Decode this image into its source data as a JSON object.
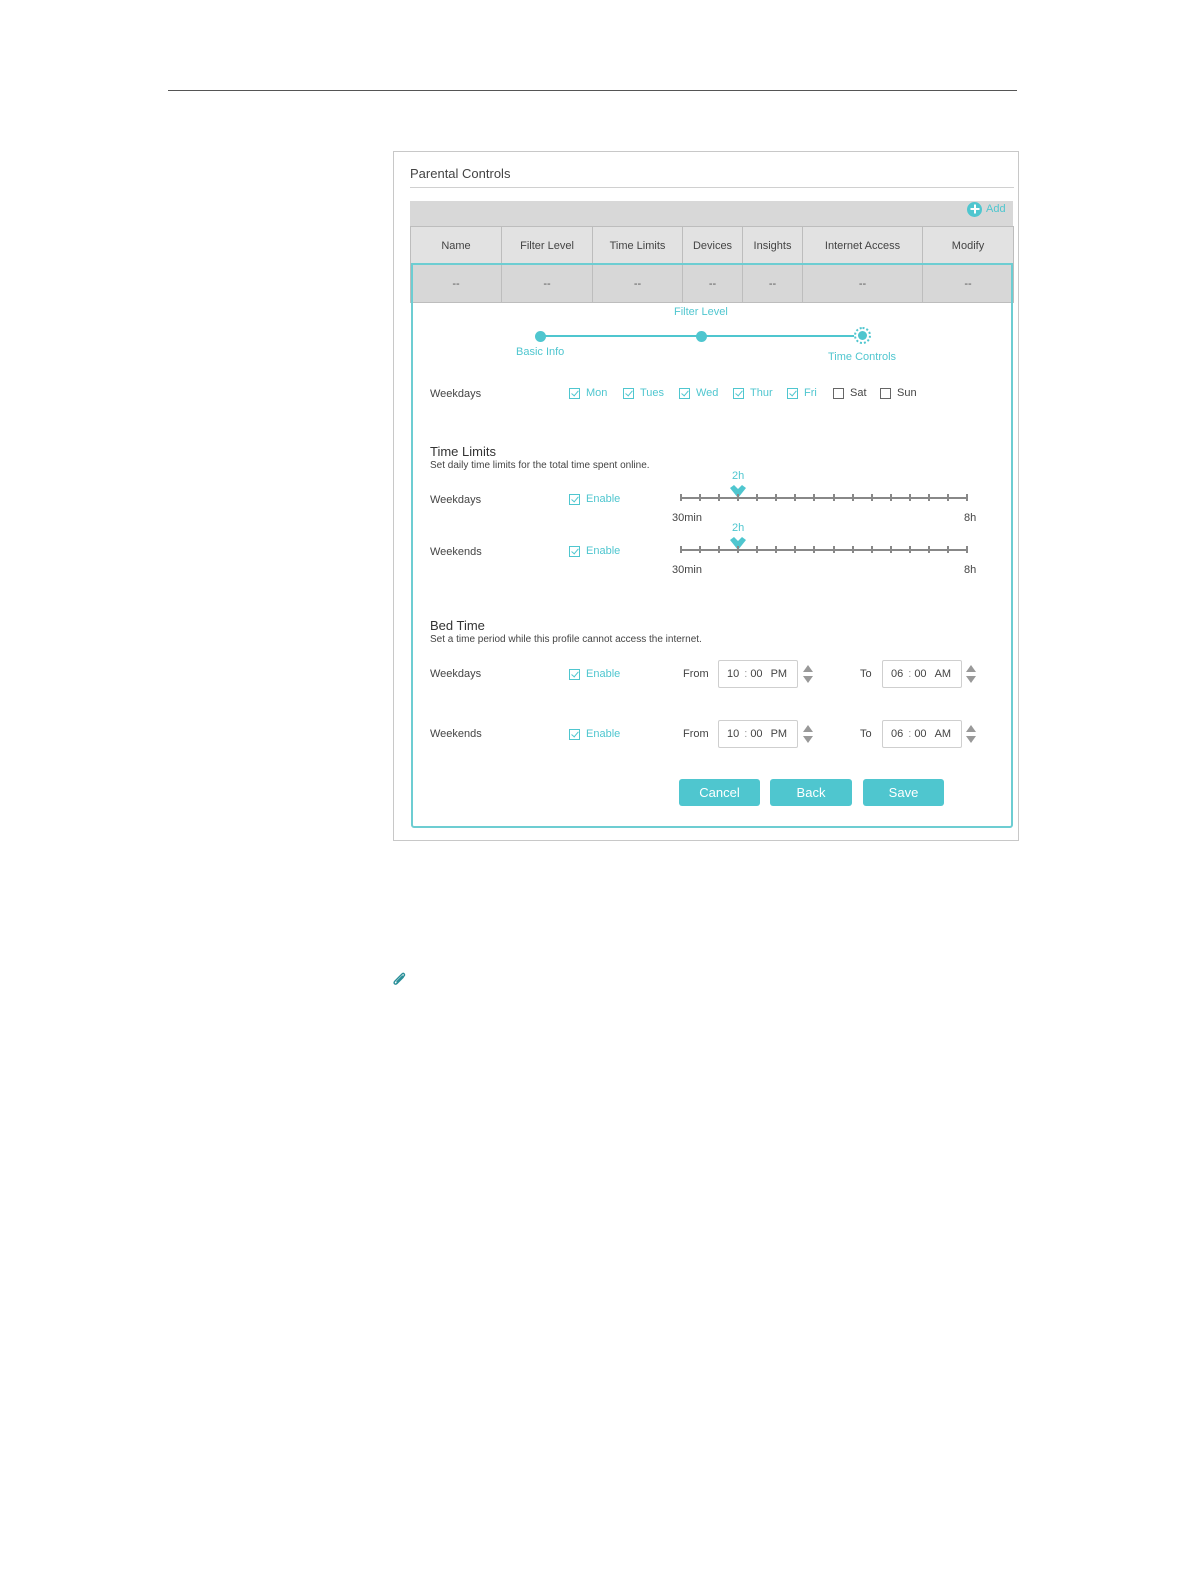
{
  "panel": {
    "title": "Parental Controls",
    "add_label": "Add"
  },
  "table": {
    "columns": [
      "Name",
      "Filter Level",
      "Time Limits",
      "Devices",
      "Insights",
      "Internet Access",
      "Modify"
    ],
    "row": [
      "--",
      "--",
      "--",
      "--",
      "--",
      "--",
      "--"
    ]
  },
  "steps": {
    "basic": "Basic Info",
    "filter": "Filter Level",
    "time": "Time Controls"
  },
  "weekdays": {
    "label": "Weekdays",
    "days": [
      {
        "name": "Mon",
        "checked": true
      },
      {
        "name": "Tues",
        "checked": true
      },
      {
        "name": "Wed",
        "checked": true
      },
      {
        "name": "Thur",
        "checked": true
      },
      {
        "name": "Fri",
        "checked": true
      },
      {
        "name": "Sat",
        "checked": false
      },
      {
        "name": "Sun",
        "checked": false
      }
    ]
  },
  "time_limits": {
    "title": "Time Limits",
    "desc": "Set daily time limits for the total time spent online.",
    "weekdays_label": "Weekdays",
    "weekends_label": "Weekends",
    "enable_label": "Enable",
    "min_label": "30min",
    "max_label": "8h",
    "weekdays_value": "2h",
    "weekends_value": "2h",
    "weekdays_fraction": 0.2,
    "weekends_fraction": 0.2
  },
  "bed_time": {
    "title": "Bed Time",
    "desc": "Set a time period while this profile cannot access the internet.",
    "enable_label": "Enable",
    "from_label": "From",
    "to_label": "To",
    "weekdays": {
      "label": "Weekdays",
      "from": {
        "h": "10",
        "m": "00",
        "ampm": "PM"
      },
      "to": {
        "h": "06",
        "m": "00",
        "ampm": "AM"
      }
    },
    "weekends": {
      "label": "Weekends",
      "from": {
        "h": "10",
        "m": "00",
        "ampm": "PM"
      },
      "to": {
        "h": "06",
        "m": "00",
        "ampm": "AM"
      }
    },
    "separator": ":"
  },
  "buttons": {
    "cancel": "Cancel",
    "back": "Back",
    "save": "Save"
  },
  "colors": {
    "accent": "#4fc6cf"
  },
  "icons": {
    "add": "plus-circle-icon",
    "spinner": "up-down-arrows-icon",
    "note": "paperclip-icon"
  }
}
